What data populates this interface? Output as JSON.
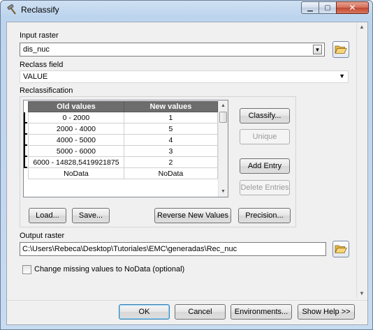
{
  "window": {
    "title": "Reclassify",
    "icon": "hammer-icon",
    "controls": {
      "minimize": "minimize-icon",
      "maximize": "maximize-icon",
      "close": "close-icon"
    }
  },
  "input_raster": {
    "label": "Input raster",
    "value": "dis_nuc"
  },
  "reclass_field": {
    "label": "Reclass field",
    "value": "VALUE"
  },
  "reclassification": {
    "label": "Reclassification",
    "columns": [
      "Old values",
      "New values"
    ],
    "rows": [
      {
        "old": "0 - 2000",
        "new": "1"
      },
      {
        "old": "2000 - 4000",
        "new": "5"
      },
      {
        "old": "4000 - 5000",
        "new": "4"
      },
      {
        "old": "5000 - 6000",
        "new": "3"
      },
      {
        "old": "6000 - 14828,5419921875",
        "new": "2"
      },
      {
        "old": "NoData",
        "new": "NoData"
      }
    ],
    "buttons": {
      "classify": "Classify...",
      "unique": "Unique",
      "add_entry": "Add Entry",
      "delete_entries": "Delete Entries",
      "load": "Load...",
      "save": "Save...",
      "reverse": "Reverse New Values",
      "precision": "Precision..."
    }
  },
  "output_raster": {
    "label": "Output raster",
    "value": "C:\\Users\\Rebeca\\Desktop\\Tutoriales\\EMC\\generadas\\Rec_nuc"
  },
  "missing_values": {
    "label": "Change missing values to NoData (optional)",
    "checked": false
  },
  "footer": {
    "ok": "OK",
    "cancel": "Cancel",
    "environments": "Environments...",
    "show_help": "Show Help >>"
  },
  "colors": {
    "title_bar": "#bcd4ee",
    "grid_header": "#6d6d6d",
    "close_button": "#c0472f"
  }
}
